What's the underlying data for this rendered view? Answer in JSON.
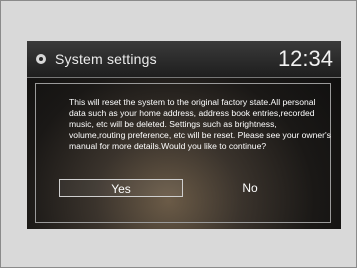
{
  "header": {
    "title": "System settings",
    "clock": "12:34",
    "icon": "settings-icon"
  },
  "dialog": {
    "message": "This will reset the system to the original factory state.All personal data such as your home address, address book entries,recorded music, etc will be deleted. Settings such as brightness, volume,routing preference, etc will be reset. Please see your owner's manual for more details.Would you like to continue?",
    "yes_label": "Yes",
    "no_label": "No"
  }
}
